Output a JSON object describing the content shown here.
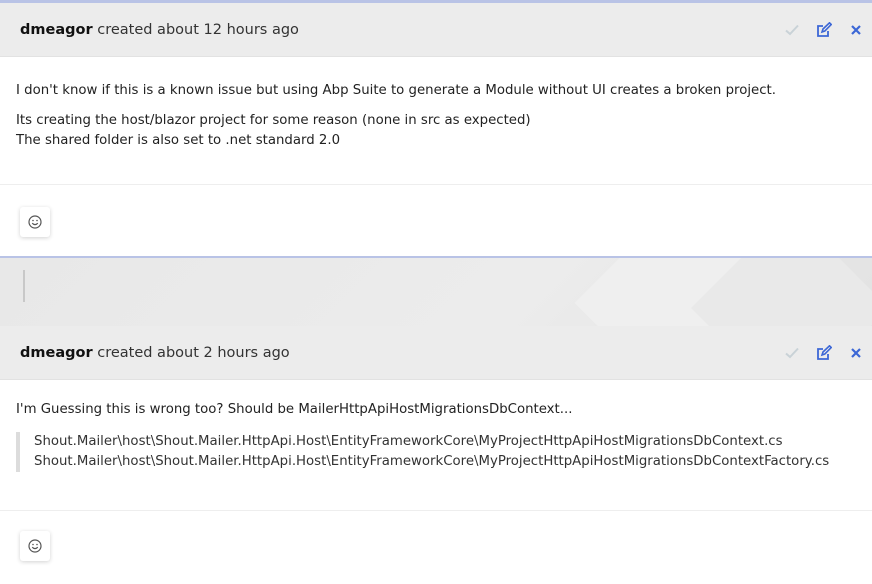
{
  "comments": [
    {
      "author": "dmeagor",
      "meta": "created about 12 hours ago",
      "paragraphs": [
        "I don't know if this is a known issue but using Abp Suite to generate a Module without UI creates a broken project.",
        "Its creating the host/blazor project for some reason (none in src as expected)",
        "The shared folder is also set to .net standard 2.0"
      ]
    },
    {
      "author": "dmeagor",
      "meta": "created about 2 hours ago",
      "paragraphs": [
        "I'm Guessing this is wrong too? Should be MailerHttpApiHostMigrationsDbContext..."
      ],
      "quote_lines": [
        "Shout.Mailer\\host\\Shout.Mailer.HttpApi.Host\\EntityFrameworkCore\\MyProjectHttpApiHostMigrationsDbContext.cs",
        "Shout.Mailer\\host\\Shout.Mailer.HttpApi.Host\\EntityFrameworkCore\\MyProjectHttpApiHostMigrationsDbContextFactory.cs"
      ]
    }
  ],
  "icons": {
    "accept": "check-icon",
    "edit": "edit-icon",
    "delete": "close-icon",
    "reaction": "smiley-icon"
  },
  "colors": {
    "accent": "#3c67d6",
    "check_muted": "#c9d2d7",
    "header_bg": "#ececec"
  }
}
